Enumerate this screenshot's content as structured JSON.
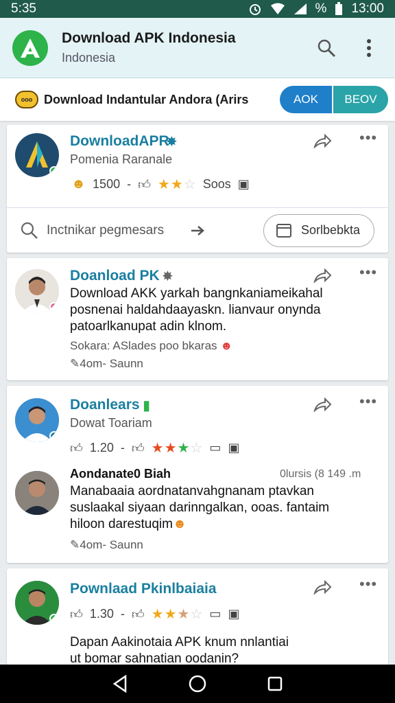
{
  "status": {
    "time": "5:35",
    "battery_pct": "%",
    "clock": "13:00"
  },
  "appbar": {
    "title": "Download APK Indonesia",
    "subtitle": "Indonesia"
  },
  "banner": {
    "text": "Download Indantular Andora (Arirs",
    "btn1": "AOK",
    "btn2": "BEOV"
  },
  "cards": [
    {
      "name": "DownloadAPR",
      "sub": "Pomenia Raranale",
      "count": "1500",
      "sep": "-",
      "tag": "Soos",
      "rating": 2,
      "search_placeholder": "Inctnikar pegmesars",
      "pill": "Sorlbebkta"
    },
    {
      "name": "Doanload PK",
      "lines": [
        "Download AKK yarkah bangnkaniameikahal",
        "posnenai haldahdaayaskn. lianvaur onynda",
        "patoarlkanupat adin klnom."
      ],
      "meta1": "Sokara: ASlades poo bkaras",
      "meta2": "4om- Saunn"
    },
    {
      "name": "Doanlears",
      "sub": "Dowat Toariam",
      "count": "1.20",
      "sep": "-",
      "rating": 3,
      "reply": {
        "name": "Aondanate0 Biah",
        "right": "0lursis (8 149 .m",
        "lines": [
          "Manabaaia aordnatanvahgnanam ptavkan",
          "suslaakal siyaan darinngalkan, ooas. fantaim",
          "hiloon darestuqim"
        ],
        "meta": "4om- Saunn"
      }
    },
    {
      "name": "Pownlaad Pkinlbaiaia",
      "count": "1.30",
      "sep": "-",
      "rating": 2.5,
      "lines": [
        "Dapan Aakinotaia APK knum nnlantiai",
        "ut bomar sahnatian oodanin?"
      ]
    }
  ],
  "colors": {
    "accent": "#1a7fa0",
    "status_bar": "#1f5a4a",
    "appbar": "#e4f3f5",
    "blue": "#1f7fc9",
    "teal": "#2aa4a8"
  }
}
